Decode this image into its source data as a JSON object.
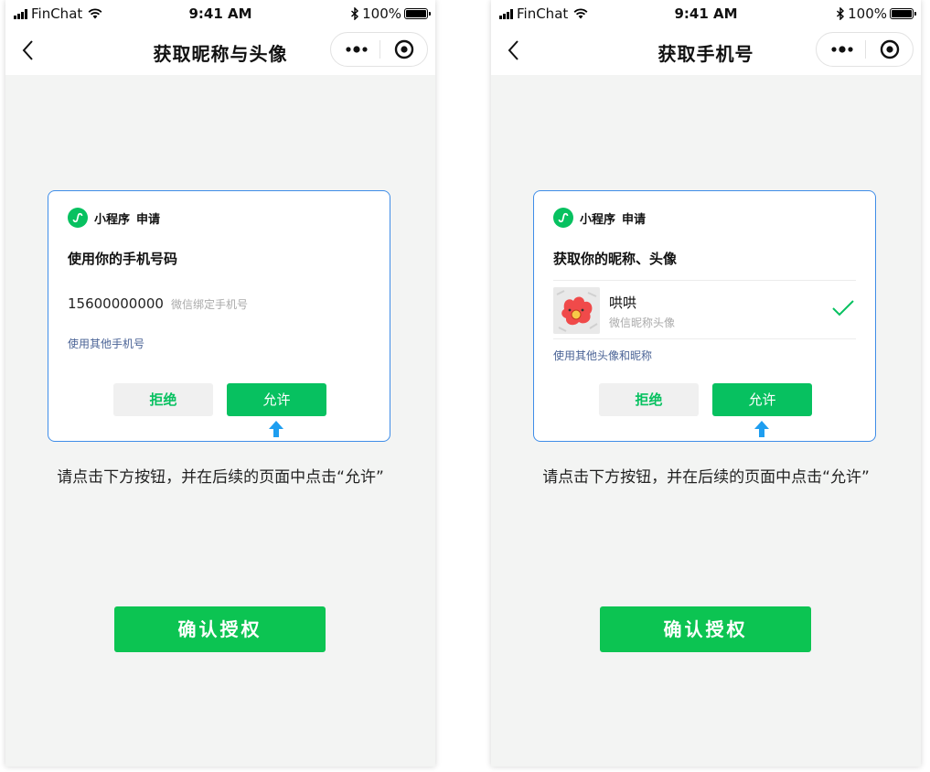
{
  "colors": {
    "accent_green": "#07c160",
    "highlight_blue": "#3f8de8",
    "link_blue": "#4a6396"
  },
  "status_bar": {
    "carrier": "FinChat",
    "time": "9:41 AM",
    "battery": "100%",
    "battery_level": 1.0
  },
  "icons": {
    "status": [
      "signal-icon",
      "wifi-icon",
      "bluetooth-icon",
      "battery-icon"
    ],
    "nav": [
      "back-icon",
      "more-icon",
      "close-miniprogram-icon"
    ],
    "card": [
      "miniprogram-logo-icon",
      "check-icon",
      "arrow-up-icon"
    ]
  },
  "screens": [
    {
      "nav_title": "获取昵称与头像",
      "card": {
        "app_name": "小程序",
        "apply_label": "申请",
        "title": "使用你的手机号码",
        "phone_number": "15600000000",
        "phone_hint": "微信绑定手机号",
        "other_link": "使用其他手机号",
        "reject_label": "拒绝",
        "allow_label": "允许"
      },
      "instruction": "请点击下方按钮，并在后续的页面中点击“允许”",
      "confirm_label": "确认授权"
    },
    {
      "nav_title": "获取手机号",
      "card": {
        "app_name": "小程序",
        "apply_label": "申请",
        "title": "获取你的昵称、头像",
        "nickname": "哄哄",
        "nickname_hint": "微信昵称头像",
        "other_link": "使用其他头像和昵称",
        "reject_label": "拒绝",
        "allow_label": "允许"
      },
      "instruction": "请点击下方按钮，并在后续的页面中点击“允许”",
      "confirm_label": "确认授权"
    }
  ]
}
